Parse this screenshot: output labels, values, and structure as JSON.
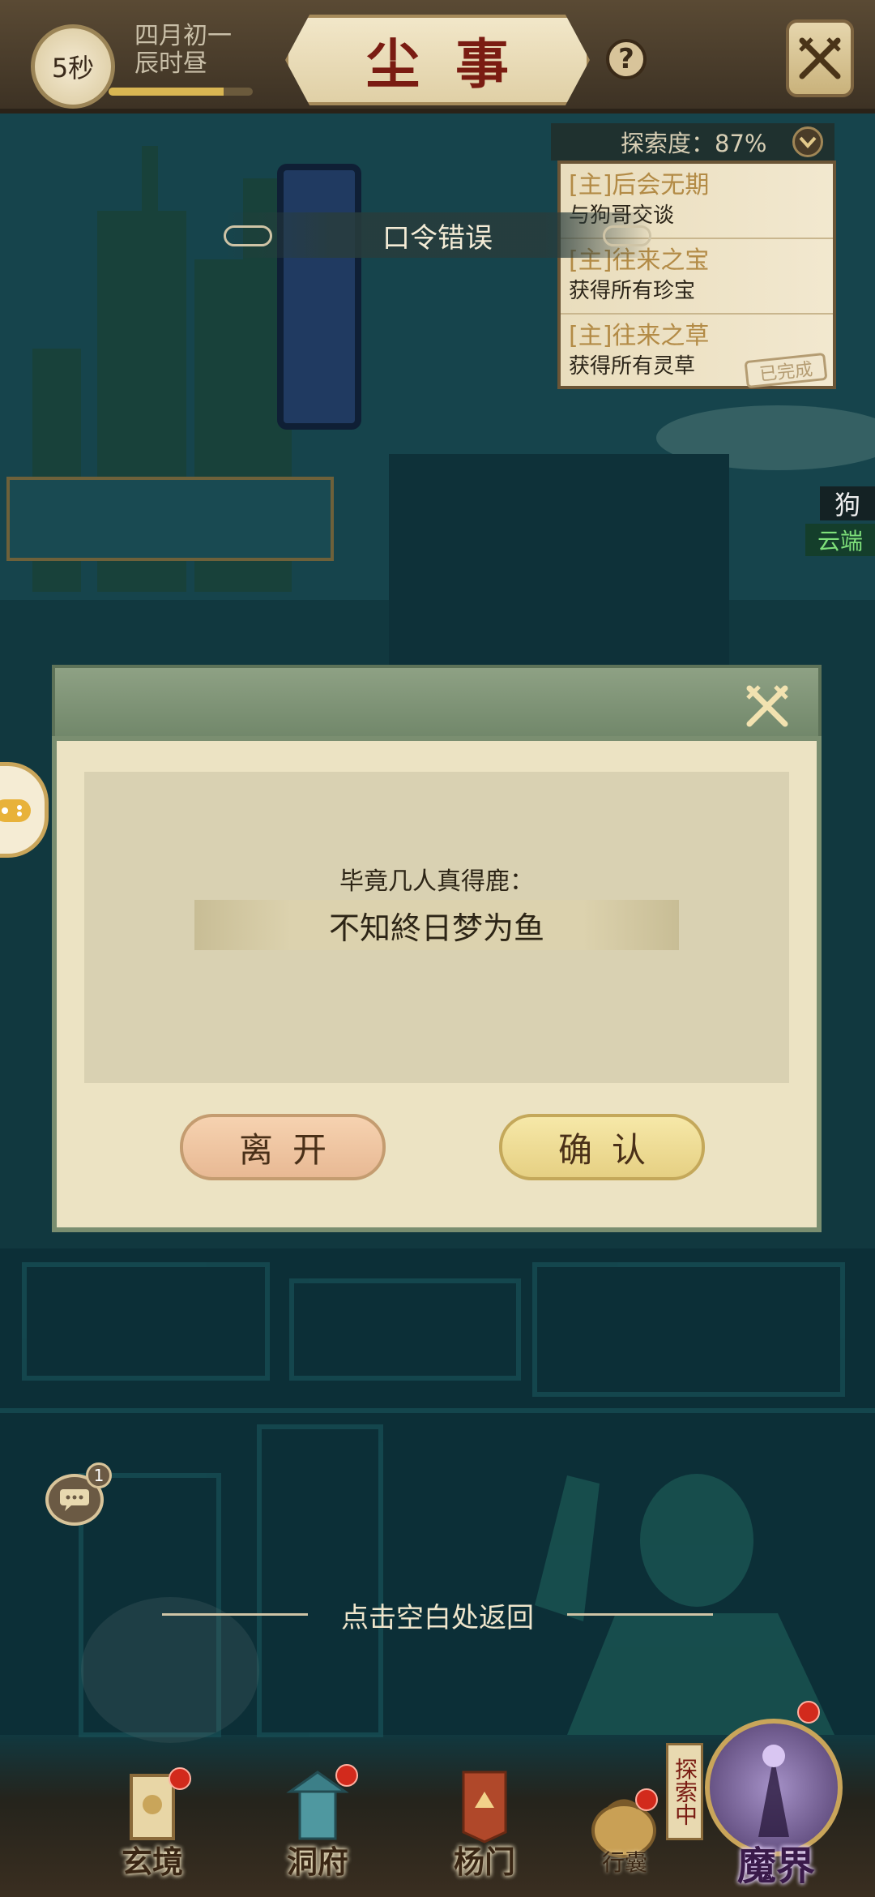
{
  "header": {
    "timer": "5秒",
    "lunar_date": "四月初一",
    "time_of_day": "辰时昼",
    "day_progress": 0.8,
    "title": "尘事",
    "help_glyph": "?",
    "close_icon": "crossed-swords-icon"
  },
  "quest_log": {
    "exploration": "探索度：87%",
    "items": [
      {
        "title": "[主]后会无期",
        "desc": "与狗哥交谈"
      },
      {
        "title": "[主]往来之宝",
        "desc": "获得所有珍宝"
      },
      {
        "title": "[主]往来之草",
        "desc": "获得所有灵草"
      }
    ],
    "completed_stamp": "已完成"
  },
  "toast": {
    "message": "口令错误"
  },
  "npc": {
    "name": "狗",
    "tag": "云端"
  },
  "dialog": {
    "prompt": "毕竟几人真得鹿：",
    "answer": "不知終日梦为鱼",
    "leave_label": "离开",
    "confirm_label": "确认",
    "close_icon": "crossed-swords-icon"
  },
  "return_hint": "点击空白处返回",
  "chat": {
    "badge_count": "1"
  },
  "bottom_nav": {
    "items": [
      {
        "label": "玄境"
      },
      {
        "label": "洞府"
      },
      {
        "label": "杨门"
      }
    ],
    "bag_label": "行囊",
    "explore_tag": "探索中",
    "world_label": "魔界"
  },
  "colors": {
    "accent_red": "#7a1c12",
    "dialog_green": "#7a8e70",
    "leave_button": "#f6d2b0",
    "confirm_button": "#f6e8a8",
    "notification_red": "#d22a1c"
  }
}
